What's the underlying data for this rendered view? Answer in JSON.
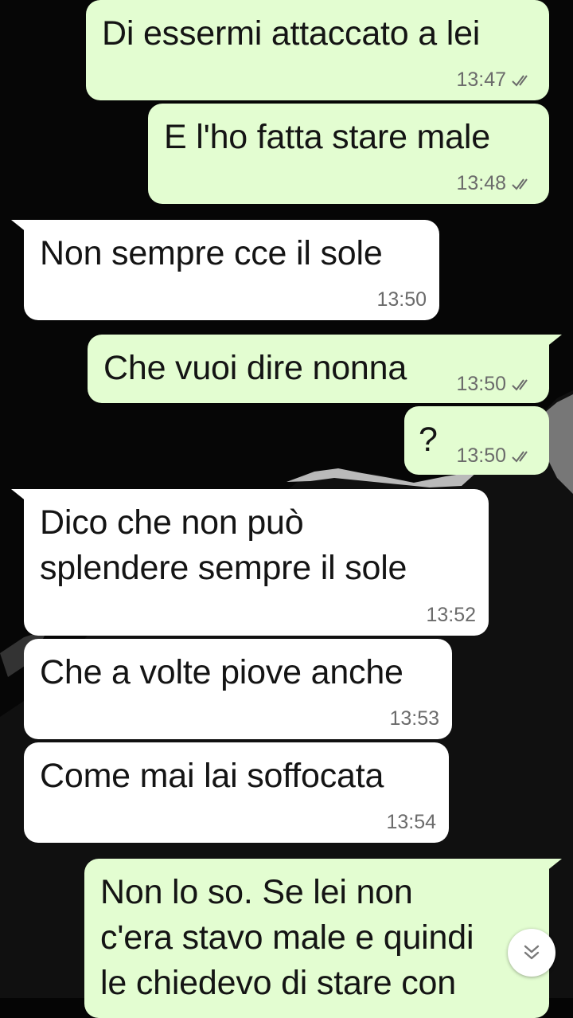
{
  "messages": [
    {
      "direction": "out",
      "text": "Di essermi attaccato a lei",
      "time": "13:47"
    },
    {
      "direction": "out",
      "text": "E l'ho fatta stare male",
      "time": "13:48"
    },
    {
      "direction": "in",
      "text": "Non sempre cce il sole",
      "time": "13:50"
    },
    {
      "direction": "out",
      "text": "Che vuoi dire nonna",
      "time": "13:50"
    },
    {
      "direction": "out",
      "text": "?",
      "time": "13:50"
    },
    {
      "direction": "in",
      "text": "Dico che non può",
      "text2": "splendere sempre il sole",
      "time": "13:52"
    },
    {
      "direction": "in",
      "text": "Che a volte piove anche",
      "time": "13:53"
    },
    {
      "direction": "in",
      "text": "Come mai lai soffocata",
      "time": "13:54"
    },
    {
      "direction": "out",
      "text": "Non lo so. Se lei non",
      "text2": "c'era stavo male e quindi",
      "text3": "le chiedevo di stare con"
    }
  ],
  "colors": {
    "outgoing_bubble": "#e3fdd1",
    "incoming_bubble": "#ffffff",
    "background": "#050505",
    "timestamp": "#6b6b6b"
  },
  "icons": {
    "read_receipt": "double-check-icon",
    "scroll_down": "double-chevron-down-icon"
  }
}
